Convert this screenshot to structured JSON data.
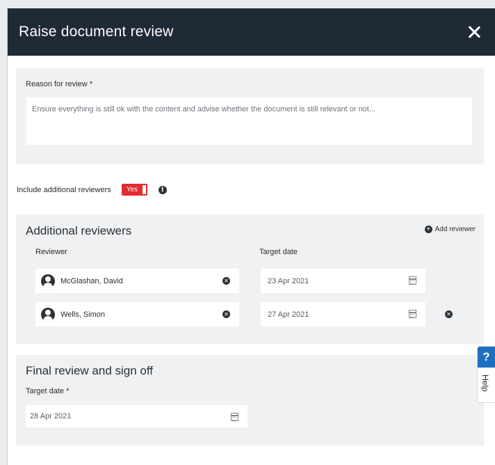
{
  "header": {
    "title": "Raise document review",
    "close_icon": "close-icon"
  },
  "reason": {
    "label": "Reason for review *",
    "value": "Ensure everything is still ok with the content and advise whether the document is still relevant or not..."
  },
  "additional_toggle": {
    "label": "Include additional reviewers",
    "value": "Yes",
    "info_icon": "info-icon"
  },
  "additional_reviewers": {
    "title": "Additional reviewers",
    "add_label": "Add reviewer",
    "col_reviewer": "Reviewer",
    "col_target_date": "Target date",
    "rows": [
      {
        "name": "McGlashan, David",
        "date": "23 Apr 2021"
      },
      {
        "name": "Wells, Simon",
        "date": "27 Apr 2021"
      }
    ]
  },
  "final": {
    "title": "Final review and sign off",
    "label": "Target date *",
    "date": "28 Apr 2021"
  },
  "help": {
    "icon": "?",
    "label": "Help"
  },
  "colors": {
    "header_bg": "#1f2a37",
    "toggle_red": "#e12b31",
    "help_blue": "#1f6fc1",
    "panel_bg": "#f0f1f2"
  }
}
